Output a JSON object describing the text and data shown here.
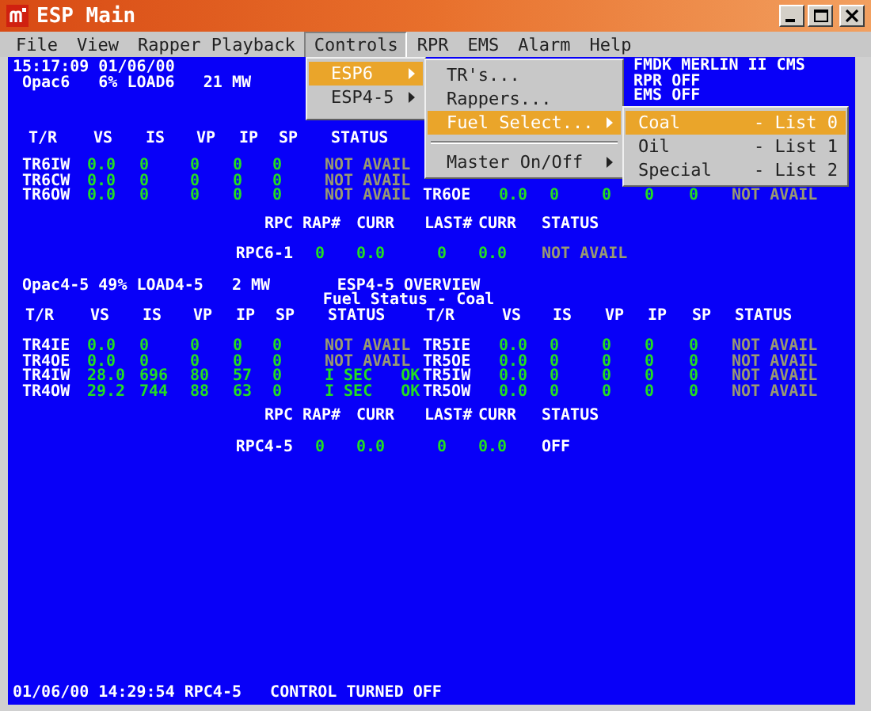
{
  "window": {
    "title": "ESP Main"
  },
  "menubar": [
    {
      "label": "File",
      "selected": false
    },
    {
      "label": "View",
      "selected": false
    },
    {
      "label": "Rapper Playback",
      "selected": false
    },
    {
      "label": "Controls",
      "selected": true
    },
    {
      "label": "RPR",
      "selected": false
    },
    {
      "label": "EMS",
      "selected": false
    },
    {
      "label": "Alarm",
      "selected": false
    },
    {
      "label": "Help",
      "selected": false
    }
  ],
  "controls_menu": {
    "items": [
      {
        "kind": "item",
        "label": "ESP6",
        "selected": true,
        "submenu": true
      },
      {
        "kind": "item",
        "label": "ESP4-5",
        "selected": false,
        "submenu": true
      }
    ]
  },
  "esp6_menu": {
    "items": [
      {
        "kind": "item",
        "label": "TR's...",
        "selected": false,
        "submenu": false
      },
      {
        "kind": "item",
        "label": "Rappers...",
        "selected": false,
        "submenu": false
      },
      {
        "kind": "item",
        "label": "Fuel Select...",
        "selected": true,
        "submenu": true
      },
      {
        "kind": "separator"
      },
      {
        "kind": "item",
        "label": "Master On/Off",
        "selected": false,
        "submenu": true
      }
    ]
  },
  "fuel_menu": {
    "items": [
      {
        "label": "Coal",
        "shortcut": "- List 0",
        "selected": true
      },
      {
        "label": "Oil",
        "shortcut": "- List 1",
        "selected": false
      },
      {
        "label": "Special",
        "shortcut": "- List 2",
        "selected": false
      }
    ]
  },
  "header": {
    "time": "15:17:09 01/06/00",
    "opac": "Opac6   6% LOAD6   21 MW",
    "info": [
      "FMDK MERLIN II CMS",
      "RPR OFF",
      "EMS OFF"
    ]
  },
  "esp6": {
    "columns": [
      "T/R",
      "VS",
      "IS",
      "VP",
      "IP",
      "SP",
      "STATUS"
    ],
    "rows": [
      {
        "left": {
          "tr": "TR6IW",
          "values": [
            "0.0",
            "0",
            "0",
            "0",
            "0"
          ],
          "status": "NOT AVAIL",
          "kind": "na"
        }
      },
      {
        "left": {
          "tr": "TR6CW",
          "values": [
            "0.0",
            "0",
            "0",
            "0",
            "0"
          ],
          "status": "NOT AVAIL",
          "kind": "na"
        }
      },
      {
        "left": {
          "tr": "TR6OW",
          "values": [
            "0.0",
            "0",
            "0",
            "0",
            "0"
          ],
          "status": "NOT AVAIL",
          "kind": "na"
        },
        "right": {
          "tr": "TR6OE",
          "values": [
            "0.0",
            "0",
            "0",
            "0",
            "0"
          ],
          "status": "NOT AVAIL",
          "kind": "na"
        }
      }
    ]
  },
  "rpc6": {
    "columns": [
      "RPC",
      "RAP#",
      "CURR",
      "LAST#",
      "CURR",
      "STATUS"
    ],
    "row": {
      "name": "RPC6-1",
      "values": [
        "0",
        "0.0",
        "0",
        "0.0"
      ],
      "status": "NOT AVAIL",
      "kind": "na"
    }
  },
  "esp45": {
    "opac": "Opac4-5 49% LOAD4-5   2 MW",
    "title": "ESP4-5 OVERVIEW",
    "subtitle": "Fuel Status - Coal",
    "columns": [
      "T/R",
      "VS",
      "IS",
      "VP",
      "IP",
      "SP",
      "STATUS"
    ],
    "right_columns": [
      "T/R",
      "VS",
      "IS",
      "VP",
      "IP",
      "SP",
      "STATUS"
    ],
    "rows": [
      {
        "left": {
          "tr": "TR4IE",
          "values": [
            "0.0",
            "0",
            "0",
            "0",
            "0"
          ],
          "status": "NOT AVAIL",
          "kind": "na"
        },
        "right": {
          "tr": "TR5IE",
          "values": [
            "0.0",
            "0",
            "0",
            "0",
            "0"
          ],
          "status": "NOT AVAIL",
          "kind": "na"
        }
      },
      {
        "left": {
          "tr": "TR4OE",
          "values": [
            "0.0",
            "0",
            "0",
            "0",
            "0"
          ],
          "status": "NOT AVAIL",
          "kind": "na"
        },
        "right": {
          "tr": "TR5OE",
          "values": [
            "0.0",
            "0",
            "0",
            "0",
            "0"
          ],
          "status": "NOT AVAIL",
          "kind": "na"
        }
      },
      {
        "left": {
          "tr": "TR4IW",
          "values": [
            "28.0",
            "696",
            "80",
            "57",
            "0"
          ],
          "status": "I SEC   OK",
          "kind": "ok"
        },
        "right": {
          "tr": "TR5IW",
          "values": [
            "0.0",
            "0",
            "0",
            "0",
            "0"
          ],
          "status": "NOT AVAIL",
          "kind": "na"
        }
      },
      {
        "left": {
          "tr": "TR4OW",
          "values": [
            "29.2",
            "744",
            "88",
            "63",
            "0"
          ],
          "status": "I SEC   OK",
          "kind": "ok"
        },
        "right": {
          "tr": "TR5OW",
          "values": [
            "0.0",
            "0",
            "0",
            "0",
            "0"
          ],
          "status": "NOT AVAIL",
          "kind": "na"
        }
      }
    ]
  },
  "rpc45": {
    "columns": [
      "RPC",
      "RAP#",
      "CURR",
      "LAST#",
      "CURR",
      "STATUS"
    ],
    "row": {
      "name": "RPC4-5",
      "values": [
        "0",
        "0.0",
        "0",
        "0.0"
      ],
      "status": "OFF",
      "kind": "off"
    }
  },
  "status_line": "01/06/00 14:29:54 RPC4-5   CONTROL TURNED OFF"
}
